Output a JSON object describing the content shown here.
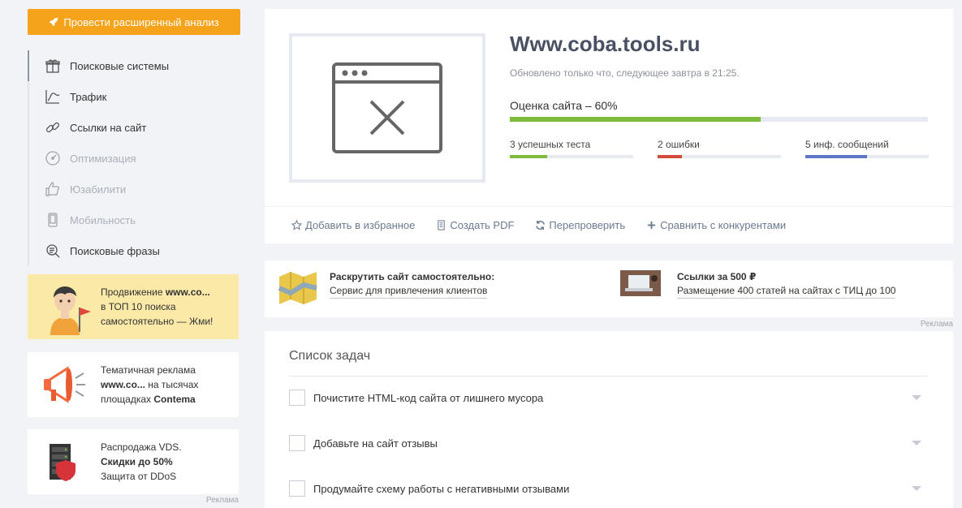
{
  "sidebar": {
    "analyze_button": "Провести расширенный анализ",
    "nav": [
      {
        "label": "Поисковые системы",
        "icon": "gift-icon",
        "disabled": false
      },
      {
        "label": "Трафик",
        "icon": "chart-icon",
        "disabled": false
      },
      {
        "label": "Ссылки на сайт",
        "icon": "link-icon",
        "disabled": false
      },
      {
        "label": "Оптимизация",
        "icon": "gauge-icon",
        "disabled": true
      },
      {
        "label": "Юзабилити",
        "icon": "thumbs-up-icon",
        "disabled": true
      },
      {
        "label": "Мобильность",
        "icon": "mobile-icon",
        "disabled": true
      },
      {
        "label": "Поисковые фразы",
        "icon": "search-list-icon",
        "disabled": false
      }
    ],
    "ads": {
      "promo": {
        "line1": "Продвижение",
        "site": "www.co...",
        "line2": "в ТОП 10 поиска",
        "line3": "самостоятельно — Жми!"
      },
      "context": {
        "line1": "Тематичная реклама",
        "site": "www.co...",
        "line2": "на тысячах",
        "line3": "площадках",
        "brand": "Contema"
      },
      "vds": {
        "line1": "Распродажа VDS.",
        "line2": "Скидки до 50%",
        "line3": "Защита от DDoS"
      },
      "label": "Реклама"
    }
  },
  "site": {
    "title": "Www.coba.tools.ru",
    "updated": "Обновлено только что, следующее завтра в 21:25.",
    "score_label": "Оценка сайта – 60%",
    "score_percent": 60,
    "stats": [
      {
        "label": "3 успешных теста",
        "fill": 30,
        "color": "#7dbb3c"
      },
      {
        "label": "2 ошибки",
        "fill": 20,
        "color": "#d24b3b"
      },
      {
        "label": "5 инф. сообщений",
        "fill": 50,
        "color": "#5a79c4"
      }
    ],
    "actions": [
      {
        "label": "Добавить в избранное",
        "icon": "star-icon"
      },
      {
        "label": "Создать PDF",
        "icon": "document-icon"
      },
      {
        "label": "Перепроверить",
        "icon": "refresh-icon"
      },
      {
        "label": "Сравнить с конкурентами",
        "icon": "plus-icon"
      }
    ]
  },
  "promo_ads": {
    "left": {
      "title": "Раскрутить сайт самостоятельно:",
      "link": "Сервис для привлечения клиентов"
    },
    "right": {
      "title": "Ссылки за 500 ₽",
      "link": "Размещение 400 статей на сайтах с ТИЦ до 100"
    },
    "label": "Реклама"
  },
  "tasks": {
    "title": "Список задач",
    "items": [
      "Почистите HTML-код сайта от лишнего мусора",
      "Добавьте на сайт отзывы",
      "Продумайте схему работы с негативными отзывами"
    ]
  },
  "colors": {
    "accent": "#f5a31a",
    "success": "#7dbb3c",
    "error": "#d24b3b",
    "info": "#5a79c4"
  }
}
